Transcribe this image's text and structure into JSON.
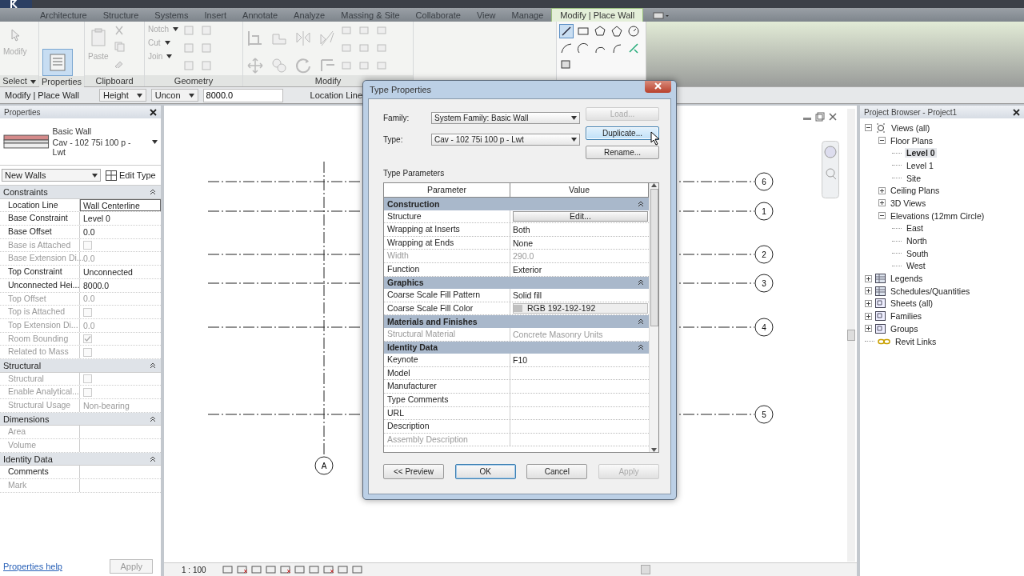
{
  "ribbon_tabs": [
    {
      "label": "Architecture",
      "selected": false
    },
    {
      "label": "Structure",
      "selected": false
    },
    {
      "label": "Systems",
      "selected": false
    },
    {
      "label": "Insert",
      "selected": false
    },
    {
      "label": "Annotate",
      "selected": false
    },
    {
      "label": "Analyze",
      "selected": false
    },
    {
      "label": "Massing & Site",
      "selected": false
    },
    {
      "label": "Collaborate",
      "selected": false
    },
    {
      "label": "View",
      "selected": false
    },
    {
      "label": "Manage",
      "selected": false
    },
    {
      "label": "Modify | Place Wall",
      "selected": true
    }
  ],
  "ribbon_panels": [
    {
      "label": "Select",
      "dropdown": true
    },
    {
      "label": "Properties",
      "dropdown": false
    },
    {
      "label": "Clipboard",
      "dropdown": false
    },
    {
      "label": "Geometry",
      "dropdown": false
    },
    {
      "label": "Modify",
      "dropdown": false
    }
  ],
  "ribbon_tools": {
    "modify": "Modify",
    "paste": "Paste",
    "notch": "Notch",
    "cut": "Cut",
    "join": "Join"
  },
  "options_bar": {
    "mode": "Modify | Place Wall",
    "height_mode": "Height",
    "top_constraint": "Uncon",
    "height_value": "8000.0",
    "location_line_label": "Location Line:"
  },
  "properties": {
    "title": "Properties",
    "type_family": "Basic Wall",
    "type_name": "Cav - 102 75i 100 p - Lwt",
    "filter": "New Walls",
    "edit_type": "Edit Type",
    "groups": [
      {
        "name": "Constraints",
        "rows": [
          {
            "name": "Location Line",
            "kind": "text",
            "value": "Wall Centerline",
            "disabled": false
          },
          {
            "name": "Base Constraint",
            "kind": "text",
            "value": "Level 0",
            "disabled": false
          },
          {
            "name": "Base Offset",
            "kind": "text",
            "value": "0.0",
            "disabled": false
          },
          {
            "name": "Base is Attached",
            "kind": "checkbox",
            "checked": false,
            "disabled": true
          },
          {
            "name": "Base Extension Di...",
            "kind": "text",
            "value": "0.0",
            "disabled": true
          },
          {
            "name": "Top Constraint",
            "kind": "text",
            "value": "Unconnected",
            "disabled": false
          },
          {
            "name": "Unconnected Hei...",
            "kind": "text",
            "value": "8000.0",
            "disabled": false
          },
          {
            "name": "Top Offset",
            "kind": "text",
            "value": "0.0",
            "disabled": true
          },
          {
            "name": "Top is Attached",
            "kind": "checkbox",
            "checked": false,
            "disabled": true
          },
          {
            "name": "Top Extension Di...",
            "kind": "text",
            "value": "0.0",
            "disabled": true
          },
          {
            "name": "Room Bounding",
            "kind": "checkbox",
            "checked": true,
            "disabled": true
          },
          {
            "name": "Related to Mass",
            "kind": "checkbox",
            "checked": false,
            "disabled": true
          }
        ]
      },
      {
        "name": "Structural",
        "rows": [
          {
            "name": "Structural",
            "kind": "checkbox",
            "checked": false,
            "disabled": true
          },
          {
            "name": "Enable Analytical...",
            "kind": "checkbox",
            "checked": false,
            "disabled": true
          },
          {
            "name": "Structural Usage",
            "kind": "text",
            "value": "Non-bearing",
            "disabled": true
          }
        ]
      },
      {
        "name": "Dimensions",
        "rows": [
          {
            "name": "Area",
            "kind": "text",
            "disabled": true
          },
          {
            "name": "Volume",
            "kind": "text",
            "disabled": true
          }
        ]
      },
      {
        "name": "Identity Data",
        "rows": [
          {
            "name": "Comments",
            "kind": "text",
            "disabled": false
          },
          {
            "name": "Mark",
            "kind": "text",
            "disabled": true
          }
        ]
      }
    ],
    "help_link": "Properties help",
    "apply": "Apply"
  },
  "grid_lines": [
    {
      "label": "6"
    },
    {
      "label": "1"
    },
    {
      "label": "2"
    },
    {
      "label": "3"
    },
    {
      "label": "4"
    },
    {
      "label": "5"
    }
  ],
  "vertical_grid_lines": [
    {
      "label": "A"
    }
  ],
  "view_scale": "1 : 100",
  "browser": {
    "title": "Project Browser - Project1",
    "tree": [
      {
        "label": "Views (all)",
        "kind": "views",
        "expanded": true,
        "selected": false,
        "children": [
          {
            "label": "Floor Plans",
            "expanded": true,
            "selected": false,
            "children": [
              {
                "label": "Level 0",
                "selected": true
              },
              {
                "label": "Level 1",
                "selected": false
              },
              {
                "label": "Site",
                "selected": false
              }
            ]
          },
          {
            "label": "Ceiling Plans",
            "expanded": false,
            "selected": false
          },
          {
            "label": "3D Views",
            "expanded": false,
            "selected": false
          },
          {
            "label": "Elevations (12mm Circle)",
            "expanded": true,
            "selected": false,
            "children": [
              {
                "label": "East",
                "selected": false
              },
              {
                "label": "North",
                "selected": false
              },
              {
                "label": "South",
                "selected": false
              },
              {
                "label": "West",
                "selected": false
              }
            ]
          }
        ]
      },
      {
        "label": "Legends",
        "kind": "legend",
        "expanded": false,
        "selected": false
      },
      {
        "label": "Schedules/Quantities",
        "kind": "schedule",
        "expanded": false,
        "selected": false
      },
      {
        "label": "Sheets (all)",
        "kind": "sheet",
        "expanded": false,
        "selected": false
      },
      {
        "label": "Families",
        "kind": "family",
        "expanded": false,
        "selected": false
      },
      {
        "label": "Groups",
        "kind": "group",
        "expanded": false,
        "selected": false
      },
      {
        "label": "Revit Links",
        "kind": "link",
        "selected": false
      }
    ]
  },
  "dialog": {
    "title": "Type Properties",
    "family_label": "Family:",
    "family_value": "System Family: Basic Wall",
    "type_label": "Type:",
    "type_value": "Cav - 102 75i 100 p - Lwt",
    "side_buttons": [
      {
        "label": "Load...",
        "disabled": true,
        "hovered": false
      },
      {
        "label": "Duplicate...",
        "disabled": false,
        "hovered": true
      },
      {
        "label": "Rename...",
        "disabled": false,
        "hovered": false
      }
    ],
    "section_label": "Type Parameters",
    "columns": [
      "Parameter",
      "Value"
    ],
    "groups": [
      {
        "name": "Construction",
        "rows": [
          {
            "name": "Structure",
            "kind": "button",
            "value": "Edit...",
            "disabled": false
          },
          {
            "name": "Wrapping at Inserts",
            "kind": "text",
            "value": "Both",
            "disabled": false
          },
          {
            "name": "Wrapping at Ends",
            "kind": "text",
            "value": "None",
            "disabled": false
          },
          {
            "name": "Width",
            "kind": "text",
            "value": "290.0",
            "disabled": true
          },
          {
            "name": "Function",
            "kind": "text",
            "value": "Exterior",
            "disabled": false
          }
        ]
      },
      {
        "name": "Graphics",
        "rows": [
          {
            "name": "Coarse Scale Fill Pattern",
            "kind": "text",
            "value": "Solid fill",
            "disabled": false
          },
          {
            "name": "Coarse Scale Fill Color",
            "kind": "color",
            "value": "RGB 192-192-192",
            "color": "#c0c0c0",
            "disabled": false
          }
        ]
      },
      {
        "name": "Materials and Finishes",
        "rows": [
          {
            "name": "Structural Material",
            "kind": "text",
            "value": "Concrete Masonry Units",
            "disabled": true
          }
        ]
      },
      {
        "name": "Identity Data",
        "rows": [
          {
            "name": "Keynote",
            "kind": "text",
            "value": "F10",
            "disabled": false
          },
          {
            "name": "Model",
            "kind": "text",
            "disabled": false
          },
          {
            "name": "Manufacturer",
            "kind": "text",
            "disabled": false
          },
          {
            "name": "Type Comments",
            "kind": "text",
            "disabled": false
          },
          {
            "name": "URL",
            "kind": "text",
            "disabled": false
          },
          {
            "name": "Description",
            "kind": "text",
            "disabled": false
          },
          {
            "name": "Assembly Description",
            "kind": "text",
            "disabled": true
          }
        ]
      }
    ],
    "footer_buttons": [
      {
        "label": "<< Preview",
        "kind": "normal"
      },
      {
        "label": "OK",
        "kind": "default"
      },
      {
        "label": "Cancel",
        "kind": "normal"
      },
      {
        "label": "Apply",
        "kind": "disabled"
      }
    ]
  }
}
